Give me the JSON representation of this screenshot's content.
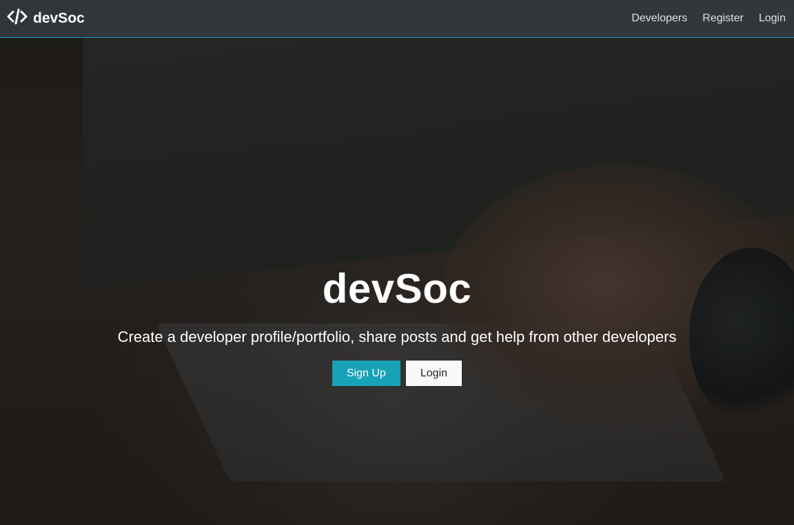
{
  "navbar": {
    "brand": "devSoc",
    "brand_icon": "code-icon",
    "links": [
      {
        "label": "Developers"
      },
      {
        "label": "Register"
      },
      {
        "label": "Login"
      }
    ],
    "border_color": "#17a2b8"
  },
  "hero": {
    "title": "devSoc",
    "subtitle": "Create a developer profile/portfolio, share posts and get help from other developers",
    "signup_label": "Sign Up",
    "login_label": "Login",
    "accent": "#17a2b8"
  }
}
